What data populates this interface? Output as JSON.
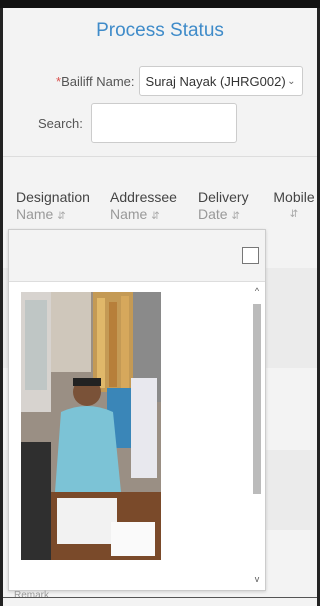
{
  "page": {
    "title": "Process Status"
  },
  "filters": {
    "bailiff_required": "*",
    "bailiff_label": "Bailiff Name:",
    "bailiff_value": "Suraj Nayak (JHRG002)",
    "search_label": "Search:",
    "search_value": ""
  },
  "table": {
    "columns": [
      {
        "line1": "Designation",
        "line2": "Name"
      },
      {
        "line1": "Addressee",
        "line2": "Name"
      },
      {
        "line1": "Delivery",
        "line2": "Date"
      },
      {
        "line1": "Mobile",
        "line2": ""
      }
    ]
  },
  "popup": {
    "image_alt": "photo-of-bailiff-at-desk"
  },
  "footer": {
    "partial_text": "Remark"
  },
  "icons": {
    "dropdown": "chevron-down-icon",
    "sort": "sort-icon",
    "scroll_up": "chevron-up-icon",
    "scroll_down": "chevron-down-icon"
  },
  "colors": {
    "accent": "#3f8bc9",
    "required": "#d9534f"
  }
}
